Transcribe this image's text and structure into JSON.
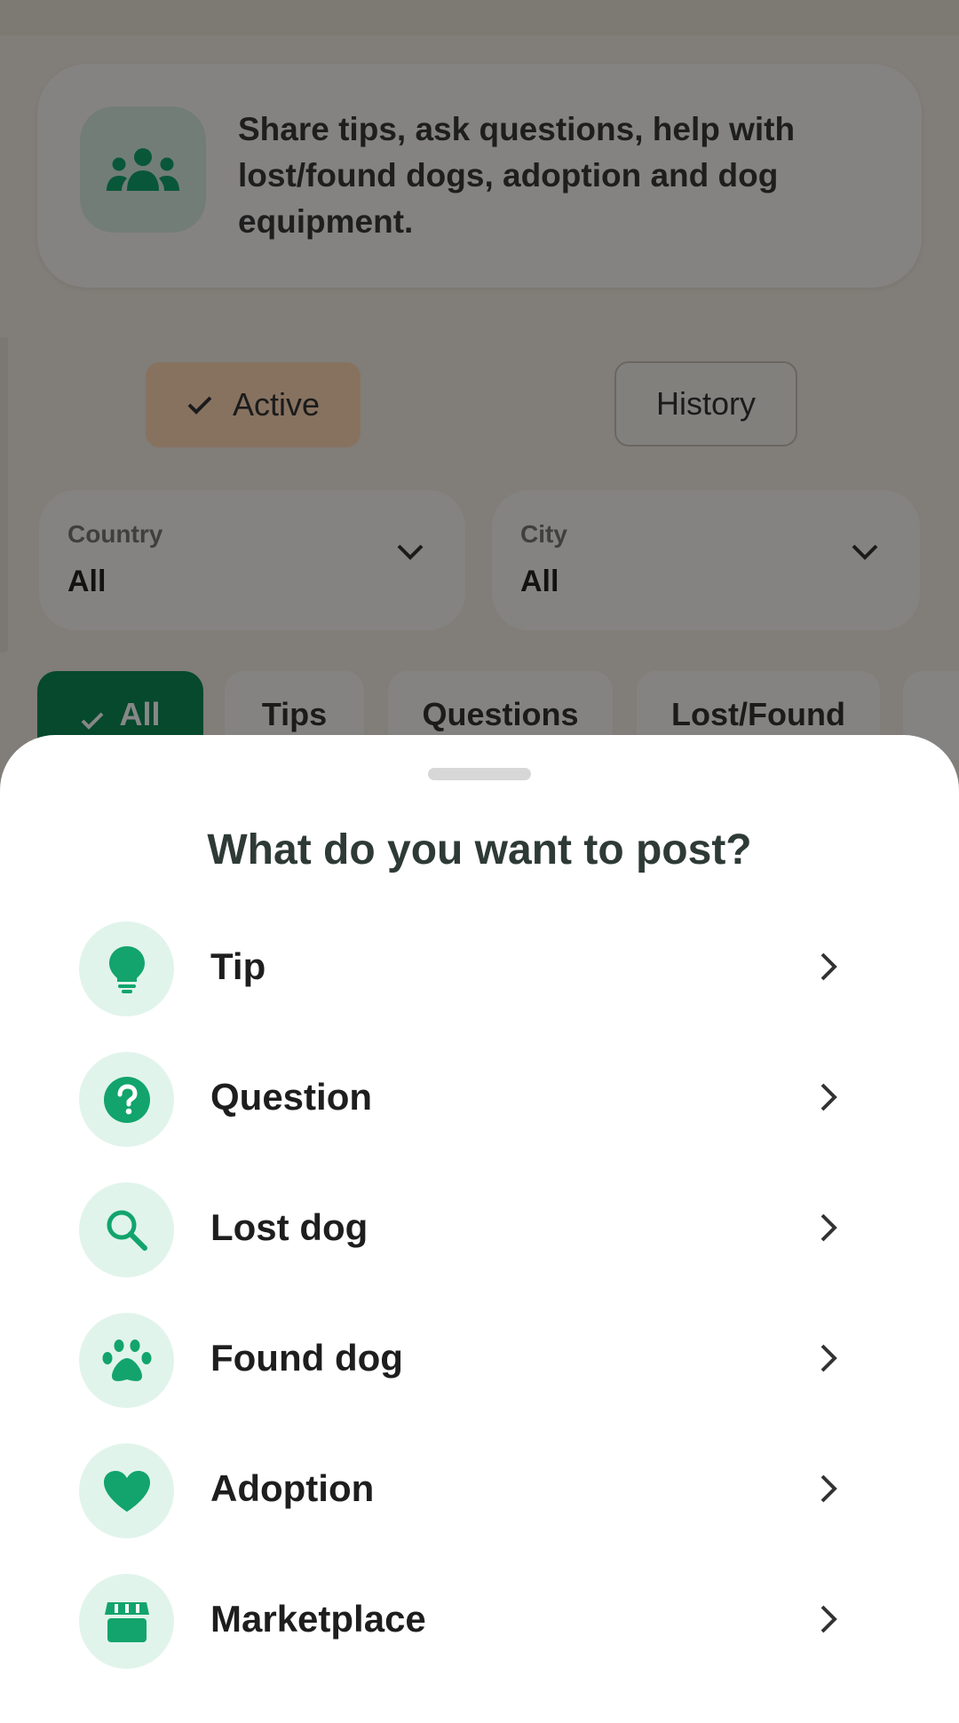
{
  "banner": {
    "text": "Share tips, ask questions, help with lost/found dogs, adoption and dog equipment."
  },
  "tabs": {
    "active": "Active",
    "history": "History"
  },
  "filters": {
    "country": {
      "label": "Country",
      "value": "All"
    },
    "city": {
      "label": "City",
      "value": "All"
    }
  },
  "chips": [
    {
      "label": "All"
    },
    {
      "label": "Tips"
    },
    {
      "label": "Questions"
    },
    {
      "label": "Lost/Found"
    }
  ],
  "sheet": {
    "title": "What do you want to post?",
    "options": [
      {
        "label": "Tip",
        "icon": "lightbulb-icon"
      },
      {
        "label": "Question",
        "icon": "question-circle-icon"
      },
      {
        "label": "Lost dog",
        "icon": "search-icon"
      },
      {
        "label": "Found dog",
        "icon": "paw-icon"
      },
      {
        "label": "Adoption",
        "icon": "heart-icon"
      },
      {
        "label": "Marketplace",
        "icon": "store-icon"
      }
    ]
  },
  "colors": {
    "accent": "#12a46c",
    "accent_dark": "#0d8a55",
    "accent_bg": "#e1f4ec",
    "active_tab_bg": "#ffd7b5"
  }
}
